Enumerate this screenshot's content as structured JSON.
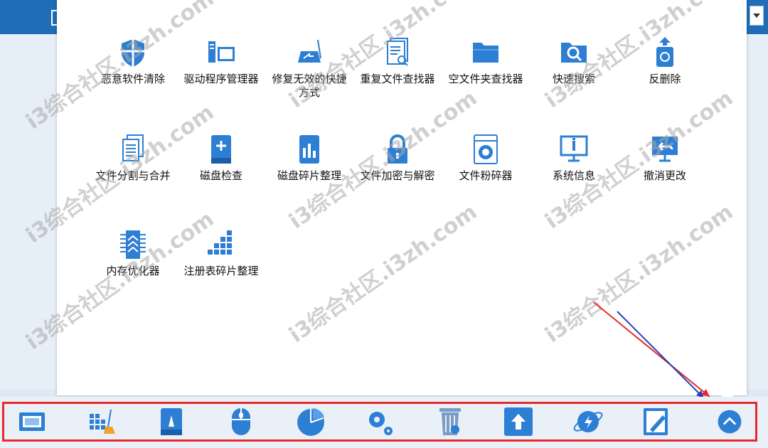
{
  "colors": {
    "accent": "#1e6db6",
    "icon": "#2d7fd4",
    "highlight_frame": "#e8292b"
  },
  "tools": [
    {
      "label": "恶意软件清除",
      "icon": "shield-icon"
    },
    {
      "label": "驱动程序管理器",
      "icon": "driver-manager-icon"
    },
    {
      "label": "修复无效的快捷方式",
      "icon": "shortcut-repair-icon"
    },
    {
      "label": "重复文件查找器",
      "icon": "duplicate-file-icon"
    },
    {
      "label": "空文件夹查找器",
      "icon": "empty-folder-icon"
    },
    {
      "label": "快速搜索",
      "icon": "quick-search-icon"
    },
    {
      "label": "反删除",
      "icon": "recycle-bin-icon"
    },
    {
      "label": "文件分割与合并",
      "icon": "file-split-icon"
    },
    {
      "label": "磁盘检查",
      "icon": "disk-check-icon"
    },
    {
      "label": "磁盘碎片整理",
      "icon": "disk-defrag-icon"
    },
    {
      "label": "文件加密与解密",
      "icon": "lock-icon"
    },
    {
      "label": "文件粉碎器",
      "icon": "shredder-icon"
    },
    {
      "label": "系统信息",
      "icon": "system-info-icon"
    },
    {
      "label": "撤消更改",
      "icon": "undo-icon"
    },
    {
      "label": "内存优化器",
      "icon": "memory-optimizer-icon"
    },
    {
      "label": "注册表碎片整理",
      "icon": "registry-defrag-icon"
    }
  ],
  "bottom_icons": [
    "window-icon",
    "cleanup-icon",
    "disk-icon",
    "mouse-icon",
    "pie-chart-icon",
    "settings-icon",
    "recycle-bin-icon",
    "upload-icon",
    "planet-icon",
    "edit-document-icon",
    "chevron-up-icon"
  ],
  "watermark": "i3综合社区.i3zh.com"
}
